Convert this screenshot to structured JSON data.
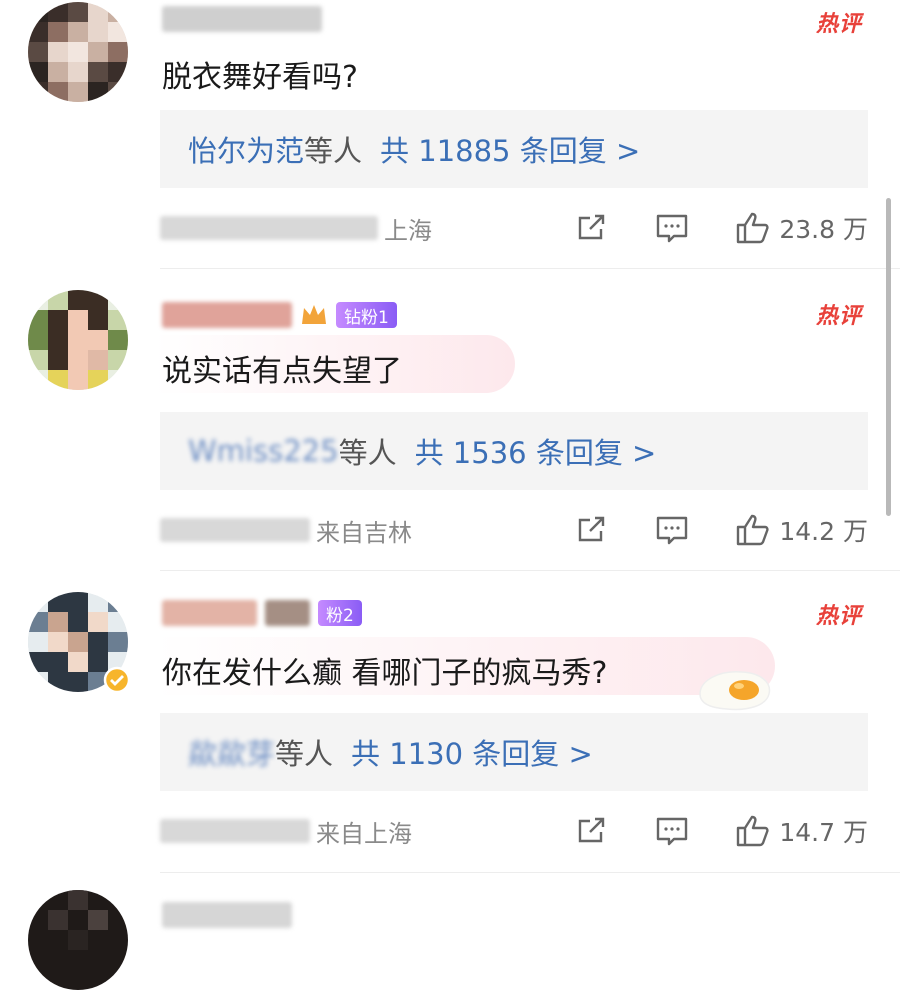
{
  "hot_label": "热评",
  "comments": [
    {
      "text": "脱衣舞好看吗?",
      "reply_names": "怡尔为范",
      "reply_suffix": "等人",
      "reply_total": "共 11885 条回复 >",
      "location": "上海",
      "likes": "23.8 万",
      "avatar_colors": [
        "#2b2421",
        "#5a4a43",
        "#c9b0a2",
        "#e7d6cc",
        "#8d6e62"
      ]
    },
    {
      "text": "说实话有点失望了",
      "badge": "钻粉1",
      "reply_names": "Wmiss225",
      "reply_suffix": "等人",
      "reply_total": "共 1536 条回复 >",
      "location": "来自吉林",
      "likes": "14.2 万",
      "avatar_colors": [
        "#e9efe2",
        "#6f8a4a",
        "#3b2d24",
        "#f2c9b4",
        "#c8d6a9"
      ]
    },
    {
      "text": "你在发什么癫 看哪门子的疯马秀?",
      "badge": "粉2",
      "reply_names": "歘歘芽",
      "reply_suffix": "等人",
      "reply_total": "共 1130 条回复 >",
      "location": "来自上海",
      "likes": "14.7 万",
      "avatar_colors": [
        "#e6ecef",
        "#2d3742",
        "#c9a48f",
        "#f1d9c9",
        "#6b7e92"
      ]
    }
  ],
  "colors": {
    "hot": "#e8413a",
    "reply_link": "#3b6fb6",
    "meta": "#8a8a8a",
    "reply_bg": "#f4f4f4"
  }
}
